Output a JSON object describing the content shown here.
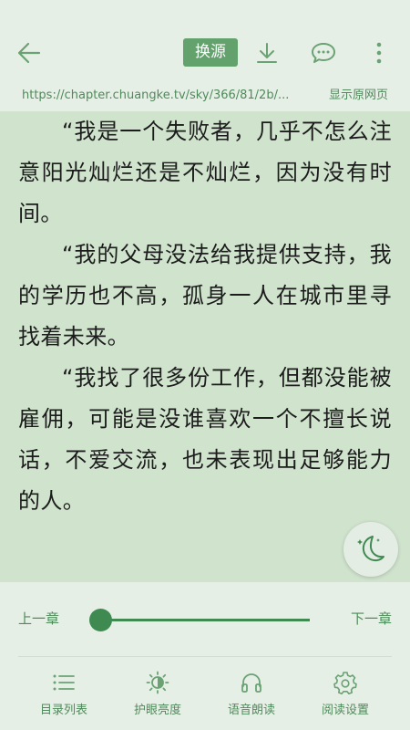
{
  "toolbar": {
    "back_icon": "arrow-left-icon",
    "source_label": "换源",
    "download_icon": "download-icon",
    "comment_icon": "comment-icon",
    "more_icon": "more-vertical-icon"
  },
  "url_bar": {
    "url": "https://chapter.chuangke.tv/sky/366/81/2b/...",
    "show_original_label": "显示原网页"
  },
  "content": {
    "paragraphs": [
      "“我是一个失败者，几乎不怎么注意阳光灿烂还是不灿烂，因为没有时间。",
      "“我的父母没法给我提供支持，我的学历也不高，孤身一人在城市里寻找着未来。",
      "“我找了很多份工作，但都没能被雇佣，可能是没谁喜欢一个不擅长说话，不爱交流，也未表现出足够能力的人。"
    ],
    "night_mode_icon": "moon-icon"
  },
  "chapter_nav": {
    "prev_label": "上一章",
    "next_label": "下一章",
    "progress": 0
  },
  "bottom_menu": {
    "items": [
      {
        "label": "目录列表",
        "icon": "list-icon"
      },
      {
        "label": "护眼亮度",
        "icon": "brightness-icon"
      },
      {
        "label": "语音朗读",
        "icon": "headphones-icon"
      },
      {
        "label": "阅读设置",
        "icon": "settings-icon"
      }
    ]
  },
  "colors": {
    "accent": "#3f8a51",
    "source_button": "#63a16d",
    "page_background": "#cfe3cd",
    "toolbar_background": "#e6efe5"
  }
}
